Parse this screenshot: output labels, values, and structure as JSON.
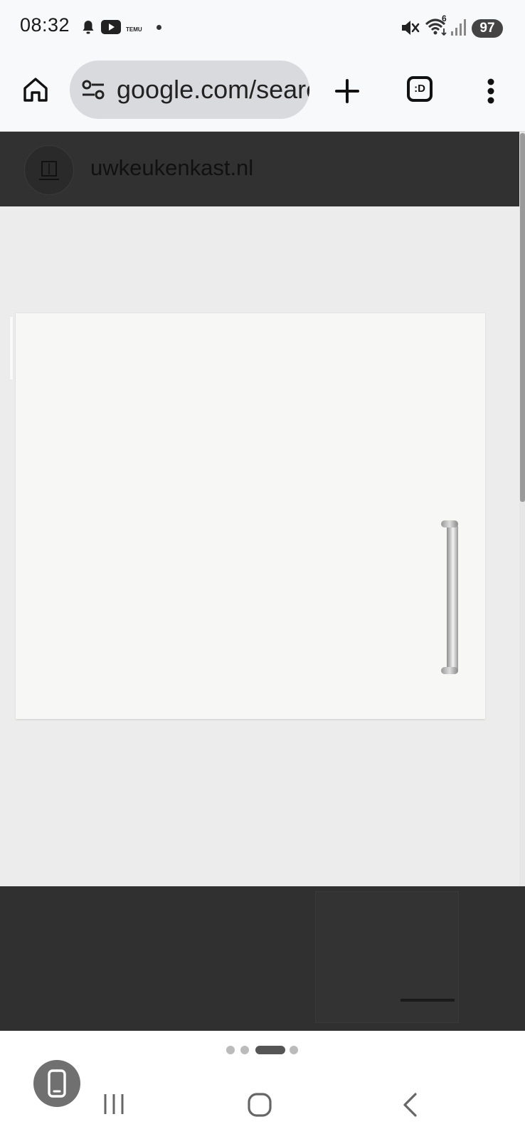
{
  "status_bar": {
    "time": "08:32",
    "notification_icons": [
      "bell-icon",
      "youtube-icon",
      "temu-icon"
    ],
    "temu_text": "TEMU",
    "right_icons": [
      "mute-icon",
      "wifi-6-icon",
      "signal-icon"
    ],
    "wifi_badge": "6",
    "battery": "97"
  },
  "browser": {
    "url": "google.com/search",
    "tabs_label": ":D",
    "icons": [
      "home-icon",
      "tune-icon",
      "new-tab-icon",
      "tab-switcher-icon",
      "more-menu-icon"
    ]
  },
  "site": {
    "name": "uwkeukenkast.nl"
  },
  "image": {
    "subject": "white cabinet door with stainless steel bar handle",
    "colors": {
      "door": "#f7f7f5",
      "background": "#ececec",
      "header": "#313131"
    }
  },
  "pager": {
    "count": 4,
    "active_index": 2
  },
  "nav_bar": {
    "icons": [
      "phone-icon",
      "recents-icon",
      "home-nav-icon",
      "back-icon"
    ]
  }
}
